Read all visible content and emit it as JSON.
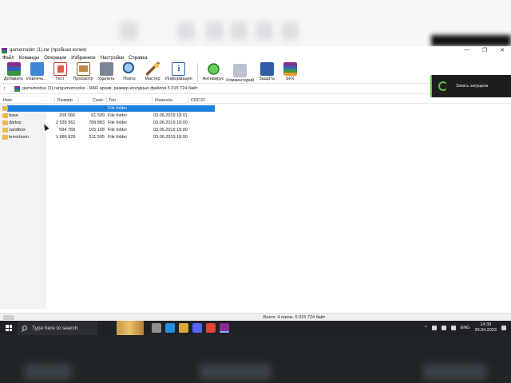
{
  "window": {
    "title": "gamemoder (1).rar (пробная копия)",
    "controls": {
      "minimize": "—",
      "maximize": "❐",
      "close": "✕"
    }
  },
  "menu": [
    "Файл",
    "Команды",
    "Операции",
    "Избранное",
    "Настройки",
    "Справка"
  ],
  "toolbar": [
    {
      "id": "add",
      "label": "Добавить",
      "icon": "add-archive-icon"
    },
    {
      "id": "extract",
      "label": "Извлечь...",
      "icon": "extract-folder-icon"
    },
    {
      "id": "test",
      "label": "Тест",
      "icon": "test-icon"
    },
    {
      "id": "view",
      "label": "Просмотр",
      "icon": "view-book-icon"
    },
    {
      "id": "delete",
      "label": "Удалить",
      "icon": "trash-icon"
    },
    {
      "id": "find",
      "label": "Поиск",
      "icon": "magnifier-icon"
    },
    {
      "id": "wizard",
      "label": "Мастер",
      "icon": "wand-icon"
    },
    {
      "id": "info",
      "label": "Информация",
      "icon": "info-icon"
    },
    {
      "id": "av",
      "label": "Антивирус",
      "icon": "antivirus-icon"
    },
    {
      "id": "comment",
      "label": "Комментарий",
      "icon": "comment-icon"
    },
    {
      "id": "protect",
      "label": "Защита",
      "icon": "shield-icon"
    },
    {
      "id": "sfx",
      "label": "SFX",
      "icon": "sfx-icon"
    }
  ],
  "address": {
    "up": "↑",
    "path": "gumumodus (1).rar\\gumumodus - RAR архив, размер исходных файлов 5 015 724 байт",
    "drop": "⌄"
  },
  "columns": {
    "name": "Имя",
    "size": "Размер",
    "packed": "Сжат",
    "type": "Тип",
    "modified": "Изменён",
    "crc": "CRC32"
  },
  "files": [
    {
      "name": "",
      "size": "",
      "packed": "",
      "type": "File folder",
      "modified": "",
      "selected": true
    },
    {
      "name": "base",
      "size": "208 066",
      "packed": "61 599",
      "type": "File folder",
      "modified": "03.06.2019 18:01"
    },
    {
      "name": "darkrp",
      "size": "2 535 961",
      "packed": "789 883",
      "type": "File folder",
      "modified": "03.06.2019 18:00"
    },
    {
      "name": "sandbox",
      "size": "584 768",
      "packed": "165 168",
      "type": "File folder",
      "modified": "03.06.2019 18:00"
    },
    {
      "name": "terrortown",
      "size": "1 686 929",
      "packed": "511 505",
      "type": "File folder",
      "modified": "03.06.2019 18:00"
    }
  ],
  "status": {
    "text": "Всего: 4 папок, 5 015 724 байт"
  },
  "notification": {
    "text": "Запись запущена"
  },
  "taskbar": {
    "search_placeholder": "Type here to search",
    "lang": "ENG",
    "time": "14:39",
    "date": "20.04.2023",
    "app_colors": [
      "#8e8e8e",
      "#1f8fe0",
      "#d8a838",
      "#5865f2",
      "#e34133",
      "#8a2c8f"
    ]
  }
}
